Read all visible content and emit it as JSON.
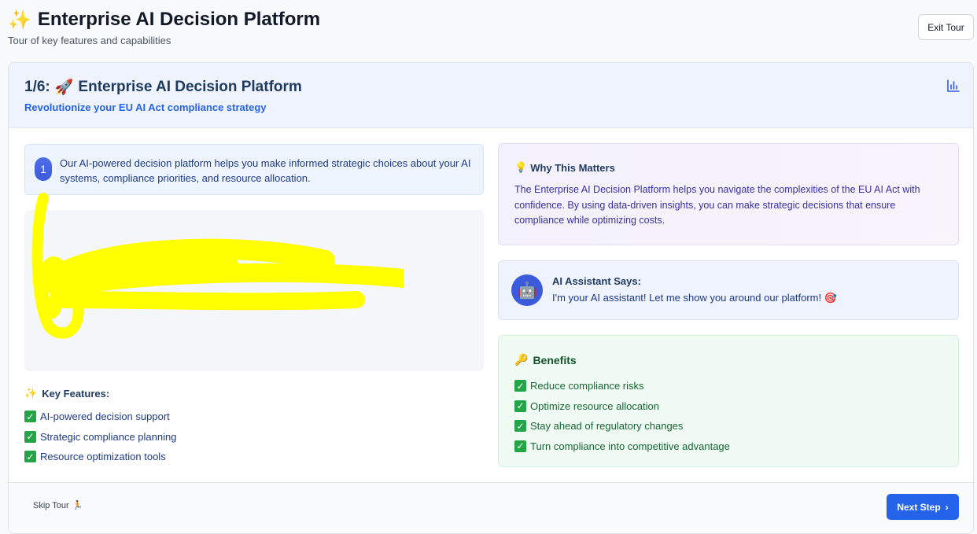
{
  "header": {
    "title": "Enterprise AI Decision Platform",
    "subtitle": "Tour of key features and capabilities",
    "exit_label": "Exit Tour"
  },
  "step": {
    "counter": "1/6:",
    "title": "Enterprise AI Decision Platform",
    "subtitle": "Revolutionize your EU AI Act compliance strategy",
    "number": "1",
    "description": "Our AI-powered decision platform helps you make informed strategic choices about your AI systems, compliance priorities, and resource allocation."
  },
  "key_features": {
    "title": "Key Features:",
    "items": [
      "AI-powered decision support",
      "Strategic compliance planning",
      "Resource optimization tools"
    ]
  },
  "why": {
    "title": "Why This Matters",
    "text": "The Enterprise AI Decision Platform helps you navigate the complexities of the EU AI Act with confidence. By using data-driven insights, you can make strategic decisions that ensure compliance while optimizing costs."
  },
  "assistant": {
    "title": "AI Assistant Says:",
    "message": "I'm your AI assistant! Let me show you around our platform! 🎯"
  },
  "benefits": {
    "title": "Benefits",
    "items": [
      "Reduce compliance risks",
      "Optimize resource allocation",
      "Stay ahead of regulatory changes",
      "Turn compliance into competitive advantage"
    ]
  },
  "footer": {
    "skip_label": "Skip Tour",
    "next_label": "Next Step"
  },
  "colors": {
    "accent": "#2563eb",
    "check_green": "#22a447",
    "annotation_yellow": "#ffff00"
  }
}
